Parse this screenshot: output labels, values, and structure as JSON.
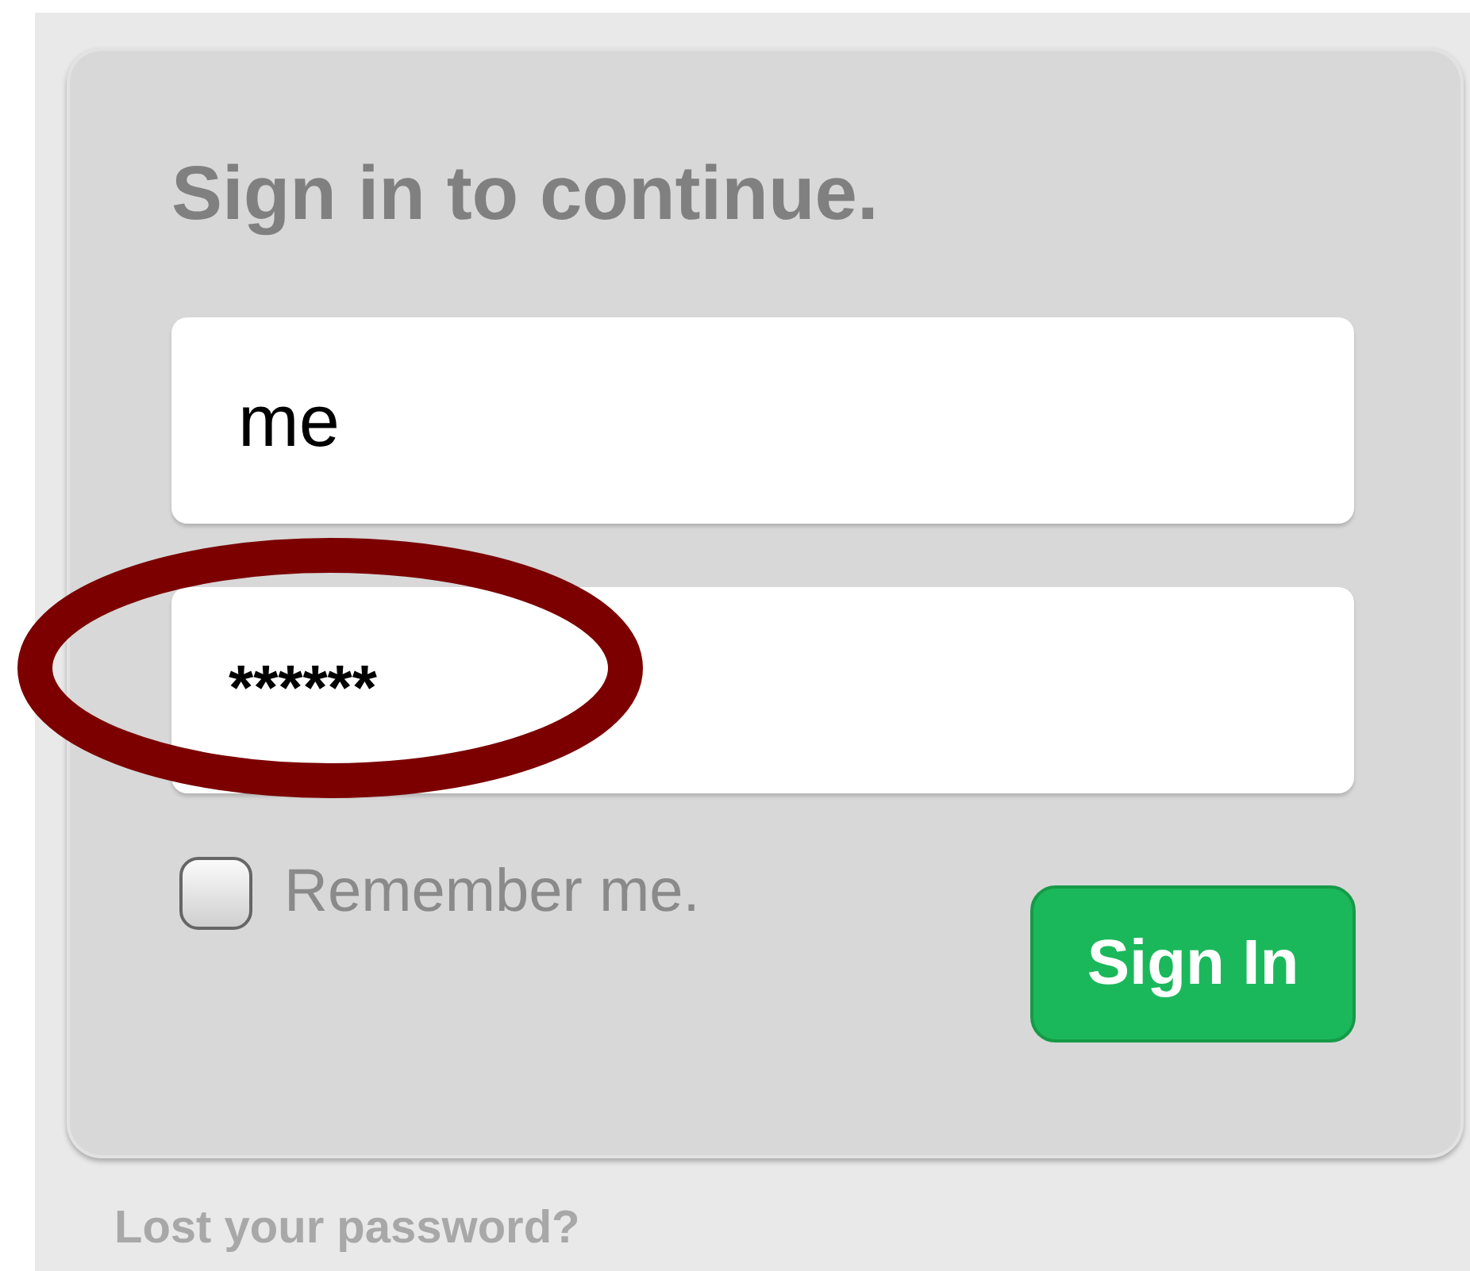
{
  "heading": "Sign in to continue.",
  "username": {
    "value": "me"
  },
  "password": {
    "value": "******"
  },
  "remember": {
    "label": "Remember me.",
    "checked": false
  },
  "submit": {
    "label": "Sign In"
  },
  "lost_password_link": "Lost your password?",
  "annotation": {
    "kind": "ellipse"
  }
}
